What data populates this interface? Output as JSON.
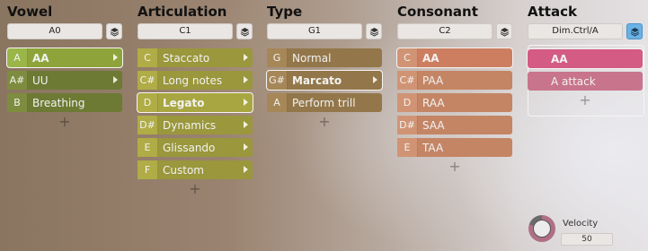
{
  "columns": [
    {
      "title": "Vowel",
      "key": "A0",
      "items": [
        {
          "note": "A",
          "label": "AA"
        },
        {
          "note": "A#",
          "label": "UU"
        },
        {
          "note": "B",
          "label": "Breathing"
        }
      ]
    },
    {
      "title": "Articulation",
      "key": "C1",
      "items": [
        {
          "note": "C",
          "label": "Staccato"
        },
        {
          "note": "C#",
          "label": "Long notes"
        },
        {
          "note": "D",
          "label": "Legato"
        },
        {
          "note": "D#",
          "label": "Dynamics"
        },
        {
          "note": "E",
          "label": "Glissando"
        },
        {
          "note": "F",
          "label": "Custom"
        }
      ]
    },
    {
      "title": "Type",
      "key": "G1",
      "items": [
        {
          "note": "G",
          "label": "Normal"
        },
        {
          "note": "G#",
          "label": "Marcato"
        },
        {
          "note": "A",
          "label": "Perform trill"
        }
      ]
    },
    {
      "title": "Consonant",
      "key": "C2",
      "items": [
        {
          "note": "C",
          "label": "AA"
        },
        {
          "note": "C#",
          "label": "PAA"
        },
        {
          "note": "D",
          "label": "RAA"
        },
        {
          "note": "D#",
          "label": "SAA"
        },
        {
          "note": "E",
          "label": "TAA"
        }
      ]
    },
    {
      "title": "Attack",
      "key": "Dim.Ctrl/A",
      "items": [
        {
          "label": "AA"
        },
        {
          "label": "A attack"
        }
      ]
    }
  ],
  "add_symbol": "+",
  "velocity": {
    "label": "Velocity",
    "value": "50",
    "level": 0.8
  }
}
